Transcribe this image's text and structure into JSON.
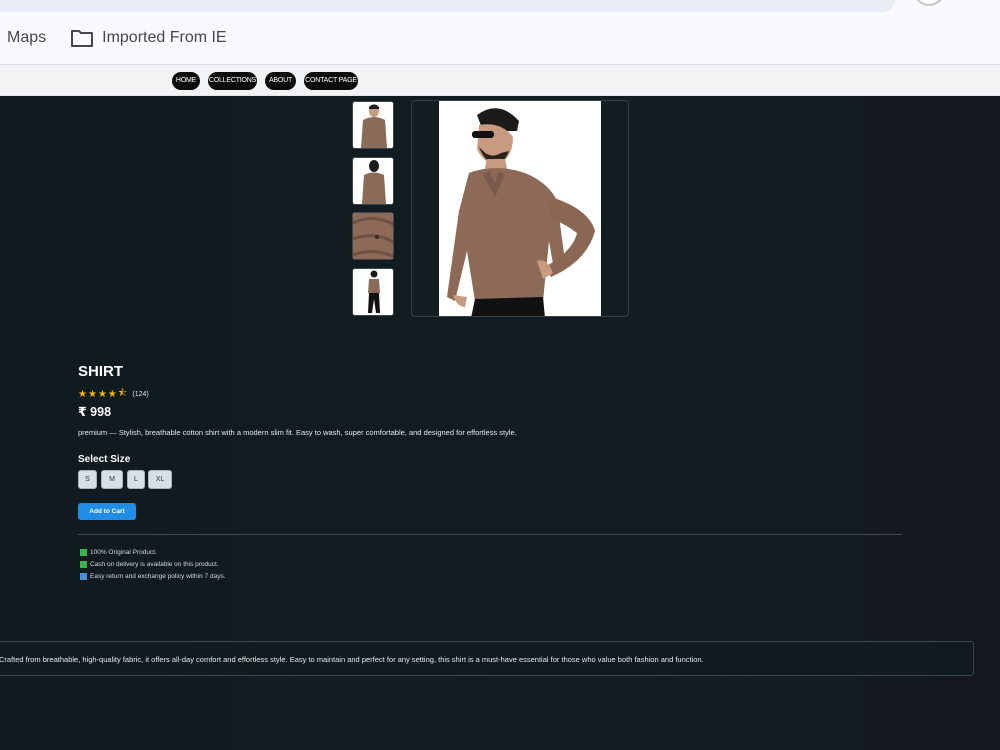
{
  "browser": {
    "bookmarks": [
      {
        "label": "Maps"
      },
      {
        "label": "Imported From IE"
      }
    ]
  },
  "nav": {
    "items": [
      "HOME",
      "COLLECTIONS",
      "ABOUT",
      "CONTACT PAGE"
    ]
  },
  "product": {
    "title": "SHIRT",
    "rating": 4.5,
    "review_count": "(124)",
    "price": "₹ 998",
    "description": "premium — Stylish, breathable cotton shirt with a modern slim fit. Easy to wash, super comfortable, and designed for effortless style.",
    "select_size_label": "Select Size",
    "sizes": [
      "S",
      "M",
      "L",
      "XL"
    ],
    "add_to_cart_label": "Add to Cart",
    "features": [
      {
        "text": "100% Original Product.",
        "icon": "green-check-icon"
      },
      {
        "text": "Cash on delivery is available on this product.",
        "icon": "green-check-icon"
      },
      {
        "text": "Easy return and exchange policy within 7 days.",
        "icon": "blue-check-icon"
      }
    ],
    "long_description": "Crafted from breathable, high-quality fabric, it offers all-day comfort and effortless style. Easy to maintain and perfect for any setting, this shirt is a must-have essential for those who value both fashion and function."
  },
  "colors": {
    "background": "#111a1f",
    "accent": "#1f8de6",
    "star": "#f5b50a",
    "nav_pill": "#0b0b0b"
  }
}
